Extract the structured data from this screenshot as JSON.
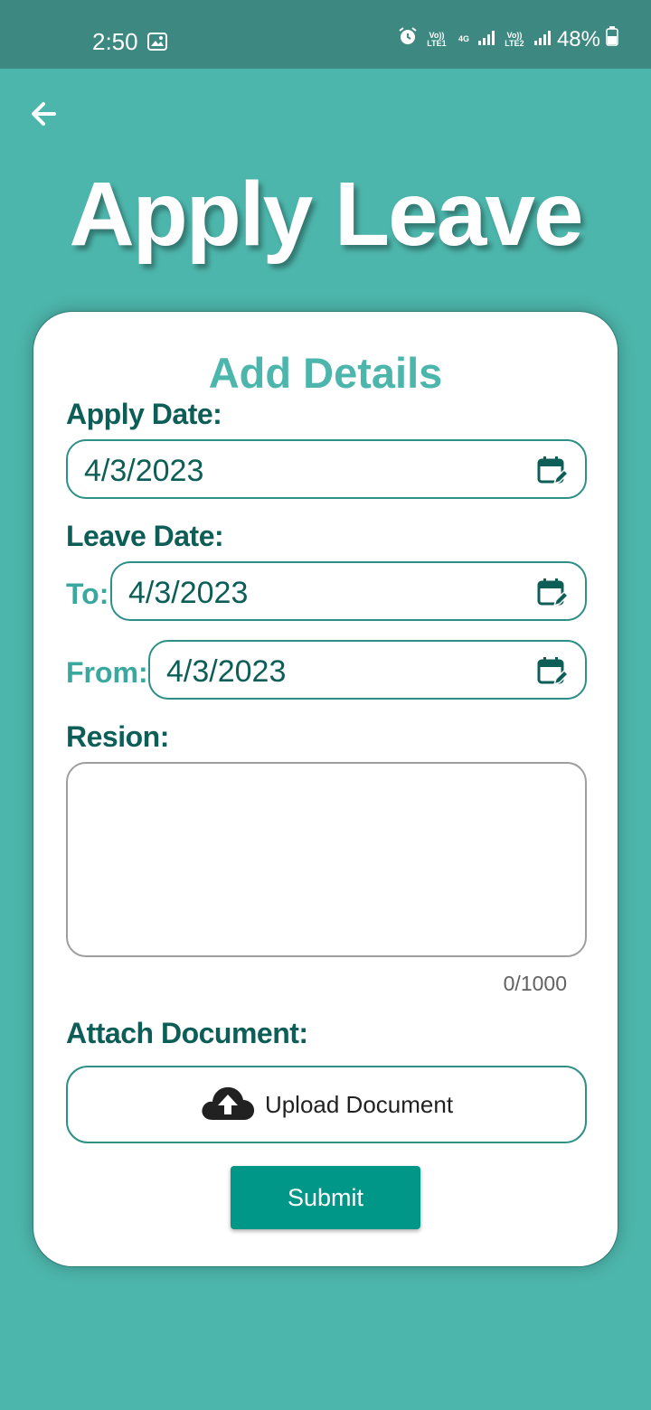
{
  "status_bar": {
    "time": "2:50",
    "sim1_label": "Vo)) LTE1",
    "network_label": "4G",
    "sim2_label": "Vo)) LTE2",
    "battery": "48%"
  },
  "header": {
    "title": "Apply Leave"
  },
  "form": {
    "heading": "Add Details",
    "apply_date_label": "Apply Date:",
    "apply_date_value": "4/3/2023",
    "leave_date_label": "Leave Date:",
    "to_label": "To:",
    "to_value": "4/3/2023",
    "from_label": "From:",
    "from_value": "4/3/2023",
    "reason_label": "Resion:",
    "reason_value": "",
    "reason_counter": "0/1000",
    "attach_label": "Attach Document:",
    "upload_label": "Upload Document",
    "submit_label": "Submit"
  },
  "icons": {
    "back": "arrow-left-icon",
    "calendar": "calendar-edit-icon",
    "upload": "cloud-upload-icon"
  },
  "colors": {
    "background": "#4db6ac",
    "status_bar": "#3d8880",
    "accent": "#009688",
    "dark_text": "#0d5e57"
  }
}
